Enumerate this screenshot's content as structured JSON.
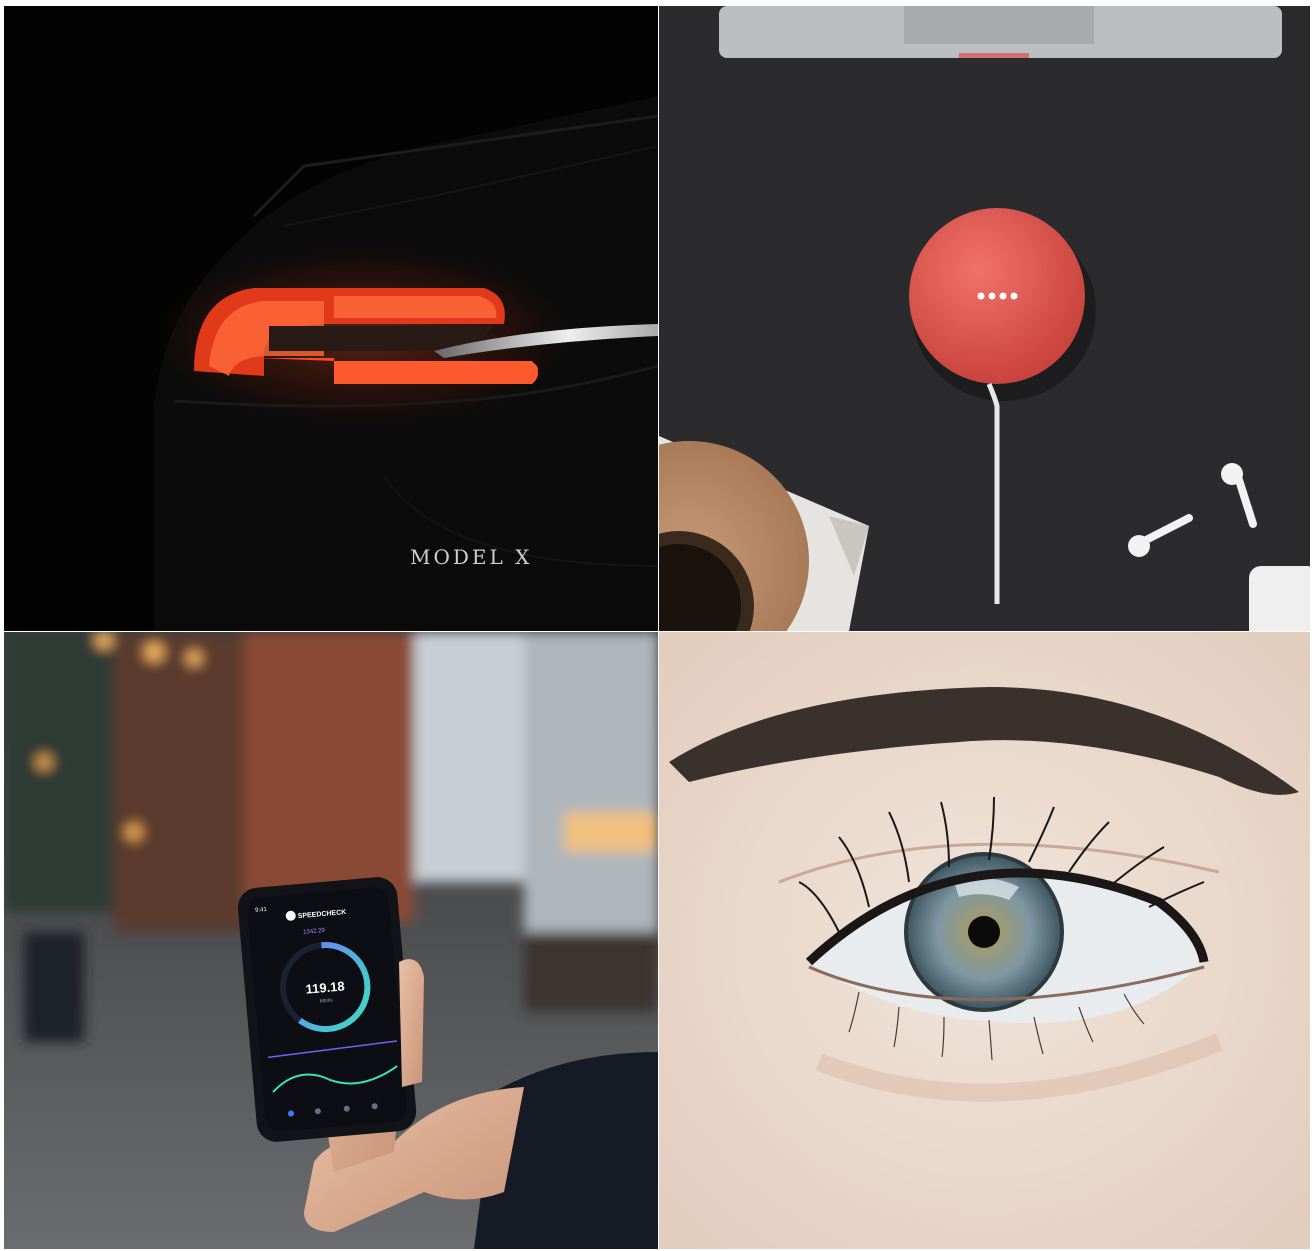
{
  "gallery": {
    "tiles": [
      {
        "name": "car-taillight-photo",
        "badge_text": "MODEL X"
      },
      {
        "name": "smart-speaker-photo"
      },
      {
        "name": "phone-speedtest-photo",
        "app_name": "SPEEDCHECK",
        "speed_value": "119.18",
        "speed_unit": "Mbit/s",
        "top_value": "1342.29",
        "status_time": "9:41"
      },
      {
        "name": "eye-closeup-photo"
      }
    ]
  }
}
